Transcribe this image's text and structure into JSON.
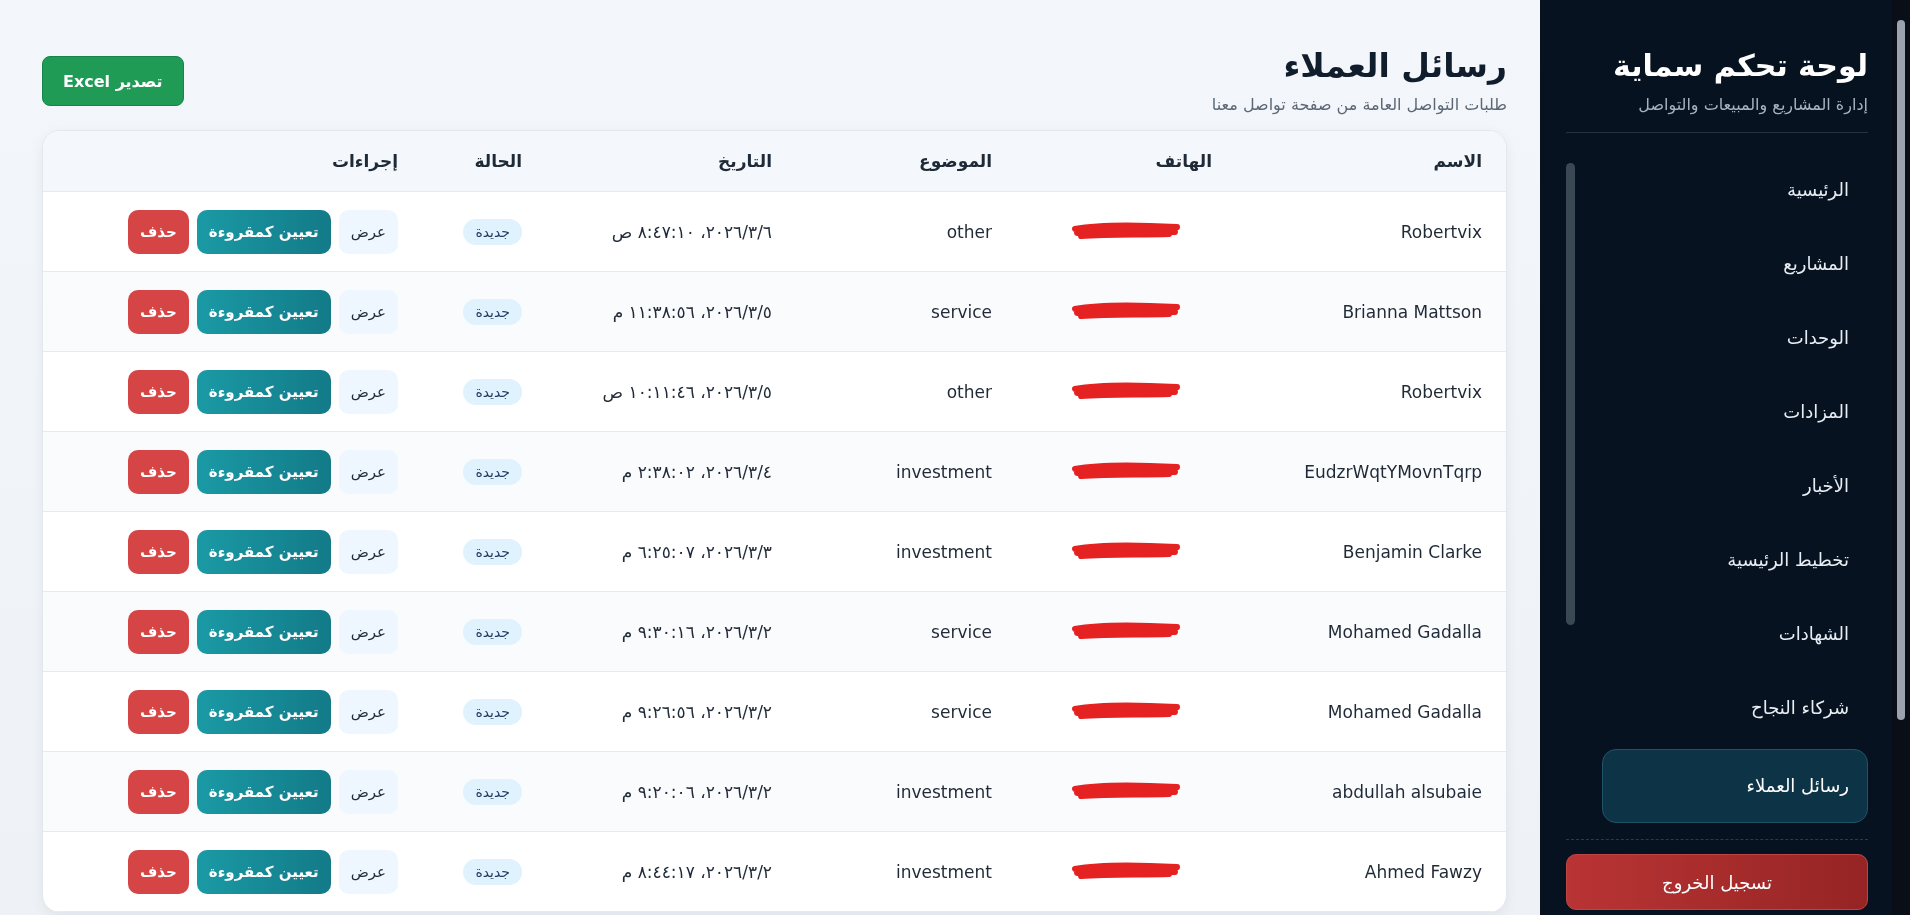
{
  "page": {
    "title": "رسائل العملاء",
    "subtitle": "طلبات التواصل العامة من صفحة تواصل معنا",
    "export_button": "تصدير Excel"
  },
  "table": {
    "columns": [
      "الاسم",
      "الهاتف",
      "الموضوع",
      "التاريخ",
      "الحالة",
      "إجراءات"
    ],
    "rows": [
      {
        "name": "Robertvix",
        "subject": "other",
        "date": "٦‏/٣‏/٢٠٢٦، ٨:٤٧:١٠ ص",
        "status": "جديدة",
        "actions": [
          {
            "label": "عرض",
            "kind": "view"
          },
          {
            "label": "تعيين كمقروءة",
            "kind": "mark"
          },
          {
            "label": "حذف",
            "kind": "delete"
          }
        ]
      },
      {
        "name": "Brianna Mattson",
        "subject": "service",
        "date": "٥‏/٣‏/٢٠٢٦، ١١:٣٨:٥٦ م",
        "status": "جديدة",
        "actions": [
          {
            "label": "عرض",
            "kind": "view"
          },
          {
            "label": "تعيين كمقروءة",
            "kind": "mark"
          },
          {
            "label": "حذف",
            "kind": "delete"
          }
        ]
      },
      {
        "name": "Robertvix",
        "subject": "other",
        "date": "٥‏/٣‏/٢٠٢٦، ١٠:١١:٤٦ ص",
        "status": "جديدة",
        "actions": [
          {
            "label": "عرض",
            "kind": "view"
          },
          {
            "label": "تعيين كمقروءة",
            "kind": "mark"
          },
          {
            "label": "حذف",
            "kind": "delete"
          }
        ]
      },
      {
        "name": "EudzrWqtYMovnTqrp",
        "subject": "investment",
        "date": "٤‏/٣‏/٢٠٢٦، ٢:٣٨:٠٢ م",
        "status": "جديدة",
        "actions": [
          {
            "label": "عرض",
            "kind": "view"
          },
          {
            "label": "تعيين كمقروءة",
            "kind": "mark"
          },
          {
            "label": "حذف",
            "kind": "delete"
          }
        ]
      },
      {
        "name": "Benjamin Clarke",
        "subject": "investment",
        "date": "٣‏/٣‏/٢٠٢٦، ٦:٢٥:٠٧ م",
        "status": "جديدة",
        "actions": [
          {
            "label": "عرض",
            "kind": "view"
          },
          {
            "label": "تعيين كمقروءة",
            "kind": "mark"
          },
          {
            "label": "حذف",
            "kind": "delete"
          }
        ]
      },
      {
        "name": "Mohamed Gadalla",
        "subject": "service",
        "date": "٢‏/٣‏/٢٠٢٦، ٩:٣٠:١٦ م",
        "status": "جديدة",
        "actions": [
          {
            "label": "عرض",
            "kind": "view"
          },
          {
            "label": "تعيين كمقروءة",
            "kind": "mark"
          },
          {
            "label": "حذف",
            "kind": "delete"
          }
        ]
      },
      {
        "name": "Mohamed Gadalla",
        "subject": "service",
        "date": "٢‏/٣‏/٢٠٢٦، ٩:٢٦:٥٦ م",
        "status": "جديدة",
        "actions": [
          {
            "label": "عرض",
            "kind": "view"
          },
          {
            "label": "تعيين كمقروءة",
            "kind": "mark"
          },
          {
            "label": "حذف",
            "kind": "delete"
          }
        ]
      },
      {
        "name": "abdullah alsubaie",
        "subject": "investment",
        "date": "٢‏/٣‏/٢٠٢٦، ٩:٢٠:٠٦ م",
        "status": "جديدة",
        "actions": [
          {
            "label": "عرض",
            "kind": "view"
          },
          {
            "label": "تعيين كمقروءة",
            "kind": "mark"
          },
          {
            "label": "حذف",
            "kind": "delete"
          }
        ]
      },
      {
        "name": "Ahmed Fawzy",
        "subject": "investment",
        "date": "٢‏/٣‏/٢٠٢٦، ٨:٤٤:١٧ م",
        "status": "جديدة",
        "actions": [
          {
            "label": "عرض",
            "kind": "view"
          },
          {
            "label": "تعيين كمقروءة",
            "kind": "mark"
          },
          {
            "label": "حذف",
            "kind": "delete"
          }
        ]
      }
    ]
  },
  "sidebar": {
    "title": "لوحة تحكم سماية",
    "subtitle": "إدارة المشاريع والمبيعات والتواصل",
    "items": [
      {
        "label": "الرئيسية",
        "selected": false
      },
      {
        "label": "المشاريع",
        "selected": false
      },
      {
        "label": "الوحدات",
        "selected": false
      },
      {
        "label": "المزادات",
        "selected": false
      },
      {
        "label": "الأخبار",
        "selected": false
      },
      {
        "label": "تخطيط الرئيسية",
        "selected": false
      },
      {
        "label": "الشهادات",
        "selected": false
      },
      {
        "label": "شركاء النجاح",
        "selected": false
      },
      {
        "label": "رسائل العملاء",
        "selected": true
      }
    ],
    "logout": "تسجيل الخروج"
  }
}
